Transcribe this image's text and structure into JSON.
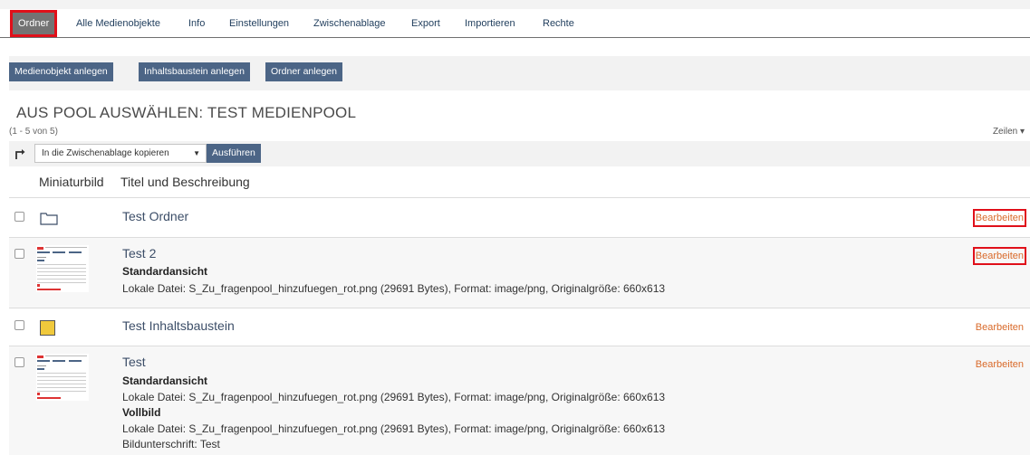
{
  "tabs": [
    {
      "label": "Ordner",
      "active": true
    },
    {
      "label": "Alle Medienobjekte"
    },
    {
      "label": "Info"
    },
    {
      "label": "Einstellungen"
    },
    {
      "label": "Zwischenablage"
    },
    {
      "label": "Export"
    },
    {
      "label": "Importieren"
    },
    {
      "label": "Rechte"
    }
  ],
  "toolbar": {
    "create_media": "Medienobjekt anlegen",
    "create_block": "Inhaltsbaustein anlegen",
    "create_folder": "Ordner anlegen"
  },
  "page_title": "AUS POOL AUSWÄHLEN: TEST MEDIENPOOL",
  "count": "(1 - 5 von 5)",
  "rows_menu": "Zeilen ▾",
  "actions": {
    "select_value": "In die Zwischenablage kopieren",
    "run": "Ausführen"
  },
  "columns": {
    "thumb": "Miniaturbild",
    "title": "Titel und Beschreibung"
  },
  "rows": [
    {
      "title": "Test Ordner",
      "edit": "Bearbeiten"
    },
    {
      "title": "Test 2",
      "sub1": "Standardansicht",
      "line1": "Lokale Datei: S_Zu_fragenpool_hinzufuegen_rot.png (29691 Bytes), Format: image/png, Originalgröße: 660x613",
      "edit": "Bearbeiten"
    },
    {
      "title": "Test Inhaltsbaustein",
      "edit": "Bearbeiten"
    },
    {
      "title": "Test",
      "sub1": "Standardansicht",
      "line1": "Lokale Datei: S_Zu_fragenpool_hinzufuegen_rot.png (29691 Bytes), Format: image/png, Originalgröße: 660x613",
      "sub2": "Vollbild",
      "line2": "Lokale Datei: S_Zu_fragenpool_hinzufuegen_rot.png (29691 Bytes), Format: image/png, Originalgröße: 660x613",
      "line3": "Bildunterschrift: Test",
      "edit": "Bearbeiten"
    }
  ],
  "colors": {
    "accent": "#4c6586",
    "highlight": "#e0101a",
    "edit_link": "#d96a2a"
  }
}
